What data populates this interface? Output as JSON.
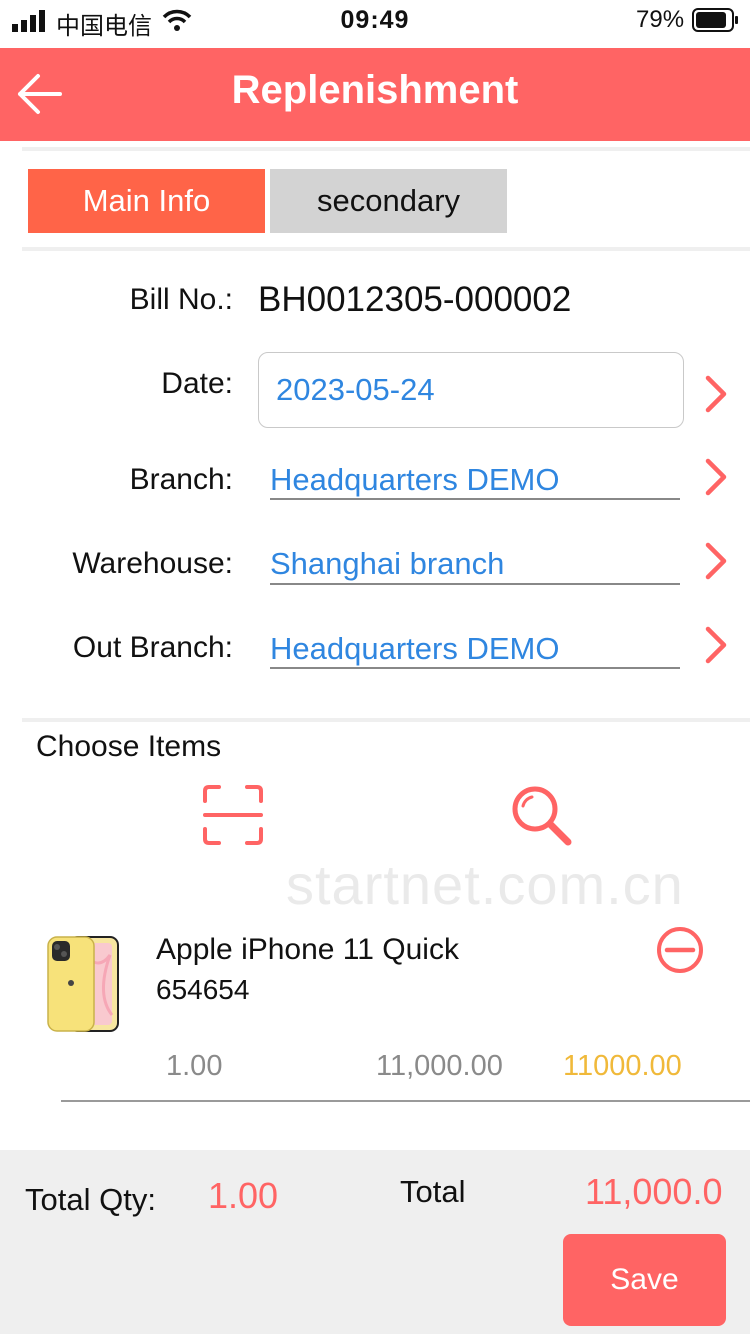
{
  "status_bar": {
    "carrier": "中国电信",
    "time": "09:49",
    "battery": "79%"
  },
  "header": {
    "title": "Replenishment"
  },
  "tabs": [
    {
      "label": "Main Info"
    },
    {
      "label": "secondary"
    }
  ],
  "form": {
    "bill_no_label": "Bill No.:",
    "bill_no": "BH0012305-000002",
    "date_label": "Date:",
    "date": "2023-05-24",
    "branch_label": "Branch:",
    "branch": "Headquarters DEMO",
    "warehouse_label": "Warehouse:",
    "warehouse": "Shanghai branch",
    "out_branch_label": "Out Branch:",
    "out_branch": "Headquarters DEMO"
  },
  "items_section": {
    "title": "Choose Items",
    "watermark": "startnet.com.cn"
  },
  "items": [
    {
      "name": "Apple iPhone 11 Quick",
      "code": "654654",
      "qty": "1.00",
      "price": "11,000.00",
      "amount": "11000.00"
    }
  ],
  "footer": {
    "total_qty_label": "Total Qty:",
    "total_qty": "1.00",
    "total_label": "Total",
    "total": "11,000.0",
    "save_label": "Save"
  },
  "colors": {
    "accent": "#ff6464",
    "tab_active": "#ff6448",
    "link_blue": "#2f86e0",
    "amount_yellow": "#f0b93a"
  },
  "icons": [
    "back-arrow-icon",
    "scan-icon",
    "search-icon",
    "remove-circle-icon",
    "chevron-right-icon",
    "signal-icon",
    "wifi-icon",
    "battery-icon"
  ]
}
